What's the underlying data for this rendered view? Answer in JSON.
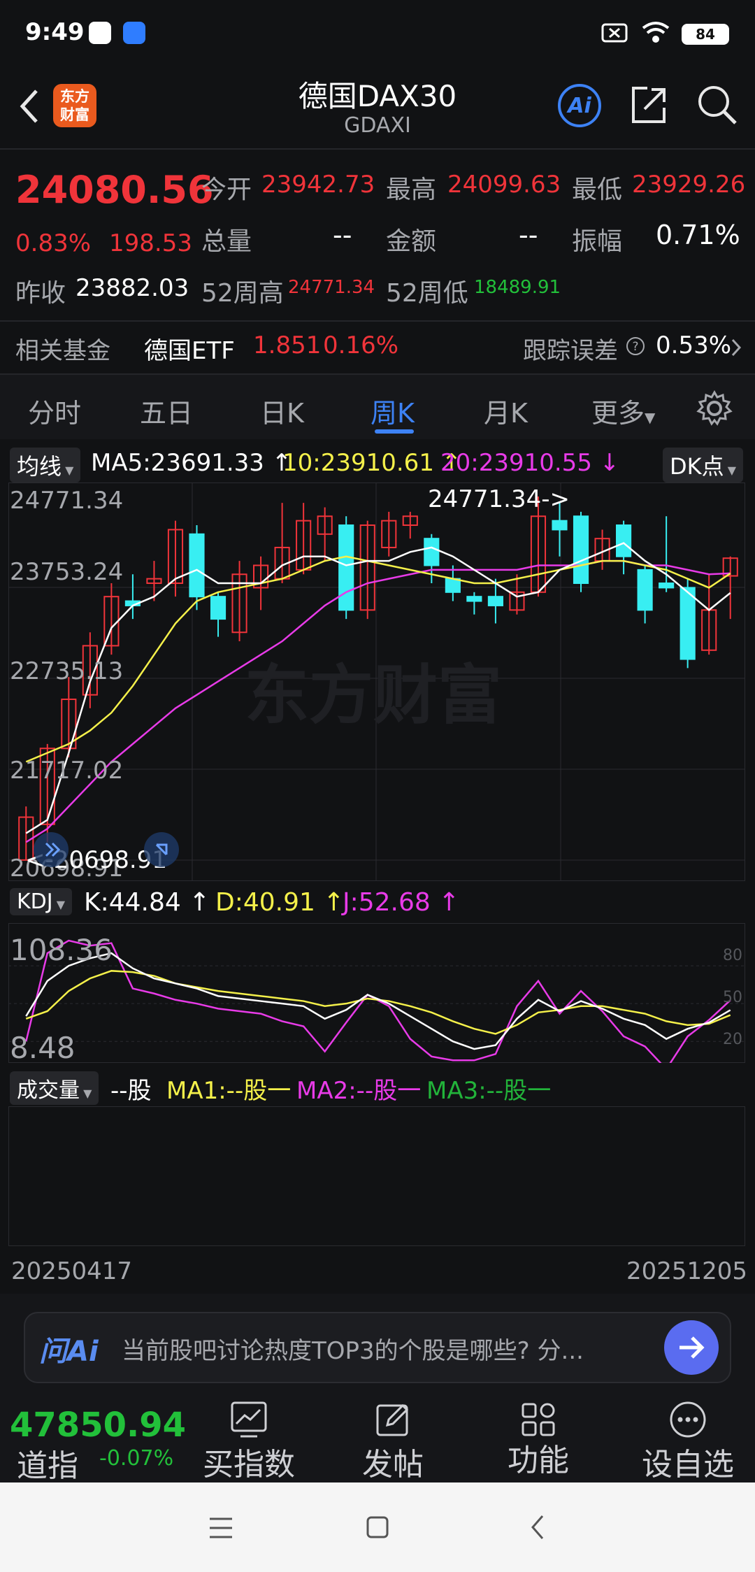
{
  "status_bar": {
    "time": "9:49",
    "battery": "84"
  },
  "header": {
    "title": "德国DAX30",
    "subtitle": "GDAXI",
    "logo_text": "东方财富",
    "ai_label": "Ai"
  },
  "quote": {
    "price": "24080.56",
    "change_pct": "0.83%",
    "change": "198.53",
    "open_label": "今开",
    "open": "23942.73",
    "high_label": "最高",
    "high": "24099.63",
    "low_label": "最低",
    "low": "23929.26",
    "volume_label": "总量",
    "volume": "--",
    "amount_label": "金额",
    "amount": "--",
    "amplitude_label": "振幅",
    "amplitude": "0.71%",
    "prev_close_label": "昨收",
    "prev_close": "23882.03",
    "w52_high_label": "52周高",
    "w52_high": "24771.34",
    "w52_low_label": "52周低",
    "w52_low": "18489.91"
  },
  "fund": {
    "label": "相关基金",
    "name": "德国ETF",
    "price": "1.851",
    "pct": "0.16%",
    "tracking_label": "跟踪误差",
    "tracking": "0.53%"
  },
  "tabs": [
    "分时",
    "五日",
    "日K",
    "周K",
    "月K",
    "更多"
  ],
  "active_tab": "周K",
  "ma_legend": {
    "selector": "均线",
    "ma5": "MA5:23691.33 ↑",
    "ma10": "10:23910.61 ↑",
    "ma20": "20:23910.55 ↓",
    "dk": "DK点"
  },
  "price_axis": [
    "24771.34",
    "23753.24",
    "22735.13",
    "21717.02",
    "20698.91"
  ],
  "annotations": {
    "max": "24771.34->",
    "min": "<-20698.91"
  },
  "watermark": "东方财富",
  "kdj_legend": {
    "selector": "KDJ",
    "k": "K:44.84 ↑",
    "d": "D:40.91 ↑",
    "j": "J:52.68 ↑"
  },
  "kdj_axis": {
    "top": "108.36",
    "bottom": "8.48",
    "l80": "80",
    "l50": "50",
    "l20": "20"
  },
  "vol_legend": {
    "selector": "成交量",
    "vol": "--股",
    "ma1": "MA1:--股一",
    "ma2": "MA2:--股一",
    "ma3": "MA3:--股一"
  },
  "date_range": {
    "start": "20250417",
    "end": "20251205"
  },
  "ai_bar": {
    "brand": "问Ai",
    "prompt": "当前股吧讨论热度TOP3的个股是哪些? 分..."
  },
  "bottom_bar": {
    "index_value": "47850.94",
    "index_name": "道指",
    "index_pct": "-0.07%",
    "buy_index": "买指数",
    "post": "发帖",
    "functions": "功能",
    "add_watch": "设自选"
  },
  "colors": {
    "up": "#f0343a",
    "down": "#38eef2",
    "ma5": "#ffffff",
    "ma10": "#f4f04a",
    "ma20": "#e83be8",
    "accent": "#3d82f5"
  },
  "chart_data": {
    "type": "candlestick",
    "period": "weekly",
    "ylim": [
      20698.91,
      24771.34
    ],
    "candles": [
      {
        "o": 20700,
        "c": 21180,
        "h": 21300,
        "l": 20698.91
      },
      {
        "o": 21100,
        "c": 21950,
        "h": 22000,
        "l": 20900
      },
      {
        "o": 21950,
        "c": 22500,
        "h": 22750,
        "l": 21850
      },
      {
        "o": 22550,
        "c": 23100,
        "h": 23250,
        "l": 22400
      },
      {
        "o": 23100,
        "c": 23650,
        "h": 23800,
        "l": 23000
      },
      {
        "o": 23600,
        "c": 23550,
        "h": 23900,
        "l": 23400
      },
      {
        "o": 23800,
        "c": 23850,
        "h": 24050,
        "l": 23600
      },
      {
        "o": 23800,
        "c": 24400,
        "h": 24500,
        "l": 23650
      },
      {
        "o": 24350,
        "c": 23650,
        "h": 24450,
        "l": 23500
      },
      {
        "o": 23650,
        "c": 23400,
        "h": 23700,
        "l": 23200
      },
      {
        "o": 23250,
        "c": 23900,
        "h": 24050,
        "l": 23150
      },
      {
        "o": 23750,
        "c": 24000,
        "h": 24100,
        "l": 23500
      },
      {
        "o": 23850,
        "c": 24200,
        "h": 24700,
        "l": 23800
      },
      {
        "o": 23950,
        "c": 24500,
        "h": 24700,
        "l": 23900
      },
      {
        "o": 24350,
        "c": 24550,
        "h": 24650,
        "l": 24050
      },
      {
        "o": 24450,
        "c": 23500,
        "h": 24550,
        "l": 23400
      },
      {
        "o": 23500,
        "c": 24450,
        "h": 24500,
        "l": 23400
      },
      {
        "o": 24200,
        "c": 24500,
        "h": 24600,
        "l": 24100
      },
      {
        "o": 24450,
        "c": 24550,
        "h": 24600,
        "l": 24300
      },
      {
        "o": 24300,
        "c": 24000,
        "h": 24350,
        "l": 23800
      },
      {
        "o": 23850,
        "c": 23700,
        "h": 24000,
        "l": 23600
      },
      {
        "o": 23650,
        "c": 23600,
        "h": 23700,
        "l": 23450
      },
      {
        "o": 23650,
        "c": 23550,
        "h": 23850,
        "l": 23350
      },
      {
        "o": 23500,
        "c": 23700,
        "h": 23900,
        "l": 23450
      },
      {
        "o": 23700,
        "c": 24550,
        "h": 24771.34,
        "l": 23650
      },
      {
        "o": 24500,
        "c": 24400,
        "h": 24700,
        "l": 24100
      },
      {
        "o": 24550,
        "c": 23800,
        "h": 24600,
        "l": 23700
      },
      {
        "o": 24050,
        "c": 24300,
        "h": 24400,
        "l": 23950
      },
      {
        "o": 24450,
        "c": 24100,
        "h": 24500,
        "l": 23900
      },
      {
        "o": 23950,
        "c": 23500,
        "h": 24000,
        "l": 23350
      },
      {
        "o": 23800,
        "c": 23750,
        "h": 24550,
        "l": 23700
      },
      {
        "o": 23750,
        "c": 22950,
        "h": 23850,
        "l": 22850
      },
      {
        "o": 23050,
        "c": 23500,
        "h": 23900,
        "l": 23000
      },
      {
        "o": 23882.03,
        "c": 24080.56,
        "h": 24099.63,
        "l": 23400
      }
    ],
    "ma5": [
      21000,
      21150,
      21900,
      22700,
      23300,
      23550,
      23650,
      23850,
      23950,
      23800,
      23800,
      23800,
      24000,
      24100,
      24100,
      24000,
      24050,
      24050,
      24150,
      24200,
      24100,
      23950,
      23800,
      23650,
      23700,
      23950,
      24050,
      24150,
      24250,
      24050,
      23900,
      23700,
      23500,
      23691.33
    ],
    "ma10": [
      21800,
      21900,
      22000,
      22150,
      22350,
      22650,
      23000,
      23350,
      23600,
      23700,
      23750,
      23800,
      23850,
      23950,
      24050,
      24100,
      24050,
      24000,
      23950,
      23900,
      23850,
      23800,
      23800,
      23850,
      23900,
      23950,
      24000,
      24050,
      24050,
      24000,
      23950,
      23850,
      23750,
      23910.61
    ],
    "ma20": [
      20900,
      21050,
      21300,
      21550,
      21800,
      22000,
      22200,
      22400,
      22550,
      22700,
      22850,
      23000,
      23150,
      23350,
      23550,
      23700,
      23800,
      23850,
      23900,
      23950,
      23950,
      23950,
      23950,
      23950,
      24000,
      24000,
      24000,
      24050,
      24050,
      24000,
      24000,
      23950,
      23900,
      23910.55
    ],
    "kdj": {
      "ylim": [
        8.48,
        108.36
      ],
      "k": [
        40,
        68,
        80,
        86,
        90,
        78,
        70,
        66,
        62,
        56,
        54,
        52,
        50,
        48,
        38,
        45,
        57,
        50,
        40,
        30,
        20,
        14,
        17,
        38,
        53,
        44,
        52,
        46,
        38,
        33,
        22,
        30,
        35,
        44.84
      ],
      "d": [
        38,
        44,
        60,
        70,
        76,
        75,
        72,
        66,
        63,
        60,
        58,
        56,
        54,
        52,
        48,
        50,
        54,
        52,
        48,
        43,
        36,
        30,
        26,
        33,
        43,
        45,
        48,
        48,
        45,
        42,
        36,
        33,
        34,
        40.91
      ],
      "j": [
        20,
        90,
        100,
        96,
        98,
        62,
        58,
        53,
        50,
        46,
        44,
        42,
        36,
        32,
        12,
        35,
        57,
        48,
        22,
        8,
        5,
        5,
        10,
        48,
        68,
        42,
        60,
        44,
        24,
        16,
        -2,
        24,
        37,
        52.68
      ]
    }
  }
}
